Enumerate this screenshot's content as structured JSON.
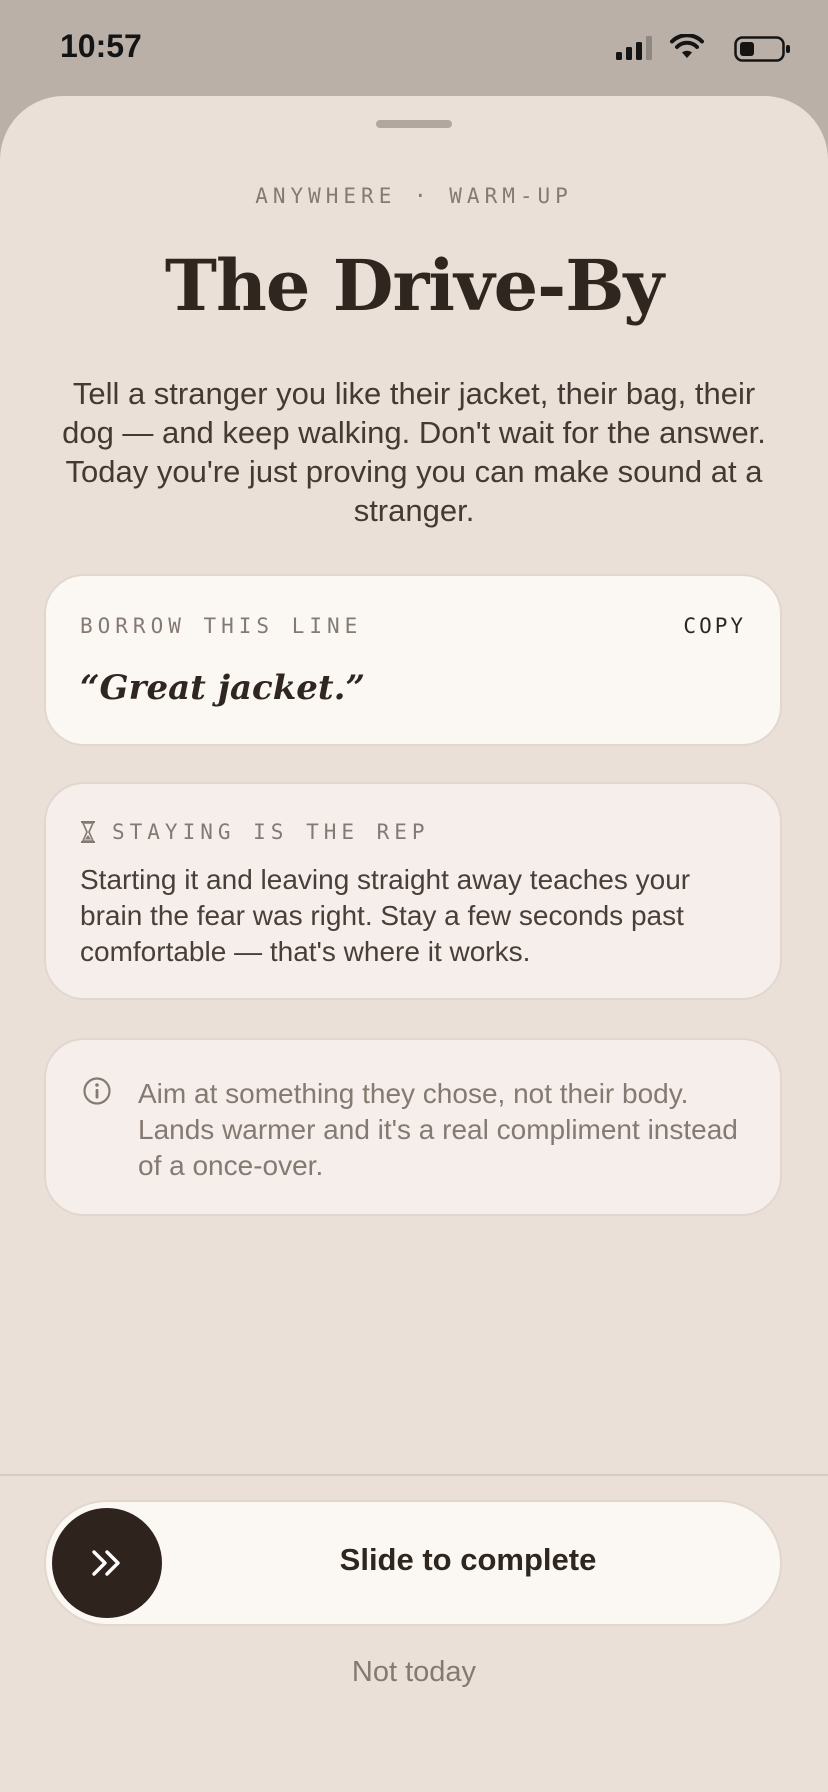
{
  "status_bar": {
    "time": "10:57",
    "icons": [
      "signal-icon",
      "wifi-icon",
      "battery-icon"
    ]
  },
  "sheet": {
    "eyebrow": "ANYWHERE · WARM-UP",
    "title": "The Drive-By",
    "description": "Tell a stranger you like their jacket, their bag, their dog — and keep walking. Don't wait for the answer. Today you're just proving you can make sound at a stranger.",
    "borrow_card": {
      "label": "BORROW THIS LINE",
      "copy_label": "COPY",
      "quote": "“Great jacket.”"
    },
    "rep_card": {
      "icon": "hourglass-icon",
      "label": "STAYING IS THE REP",
      "body": "Starting it and leaving straight away teaches your brain the fear was right. Stay a few seconds past comfortable — that's where it works."
    },
    "tip_card": {
      "icon": "info-icon",
      "body": "Aim at something they chose, not their body. Lands warmer and it's a real compliment instead of a once-over."
    },
    "slider": {
      "icon": "chevrons-icon",
      "label": "Slide to complete",
      "progress": 0
    },
    "dismiss_label": "Not today"
  },
  "colors": {
    "background": "#ebe0d8",
    "status_bar_bg": "#bab0a8",
    "ink": "#2f261f",
    "muted": "#857a72",
    "card_light": "#fbf8f4",
    "card_tinted": "#f5eeea",
    "knob": "#2f241d"
  }
}
